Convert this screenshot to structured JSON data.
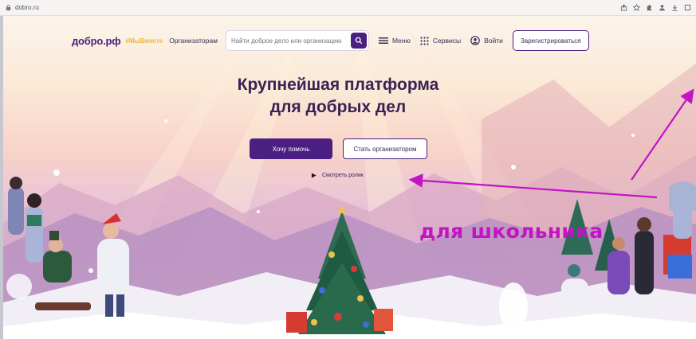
{
  "browser": {
    "url": "dobro.ru",
    "lock_icon": "lock-icon",
    "icons": [
      "share-icon",
      "star-icon",
      "extension-icon",
      "profile-icon",
      "download-icon",
      "window-icon"
    ]
  },
  "header": {
    "logo": "добро.рф",
    "hashtag": "#МыВместе",
    "organizers_link": "Организаторам",
    "search_placeholder": "Найти доброе дело или организацию",
    "menu_label": "Меню",
    "services_label": "Сервисы",
    "login_label": "Войти",
    "register_label": "Зарегистрироваться"
  },
  "hero": {
    "title_line1": "Крупнейшая платформа",
    "title_line2": "для добрых дел",
    "help_button": "Хочу помочь",
    "organizer_button": "Стать организатором",
    "video_link": "Смотреть ролик"
  },
  "overlay": {
    "annotation_text": "для школьника",
    "arrow_color": "#c214c4"
  },
  "colors": {
    "brand": "#4b1f82",
    "accent": "#f1b53a",
    "annotation": "#c214c4"
  }
}
